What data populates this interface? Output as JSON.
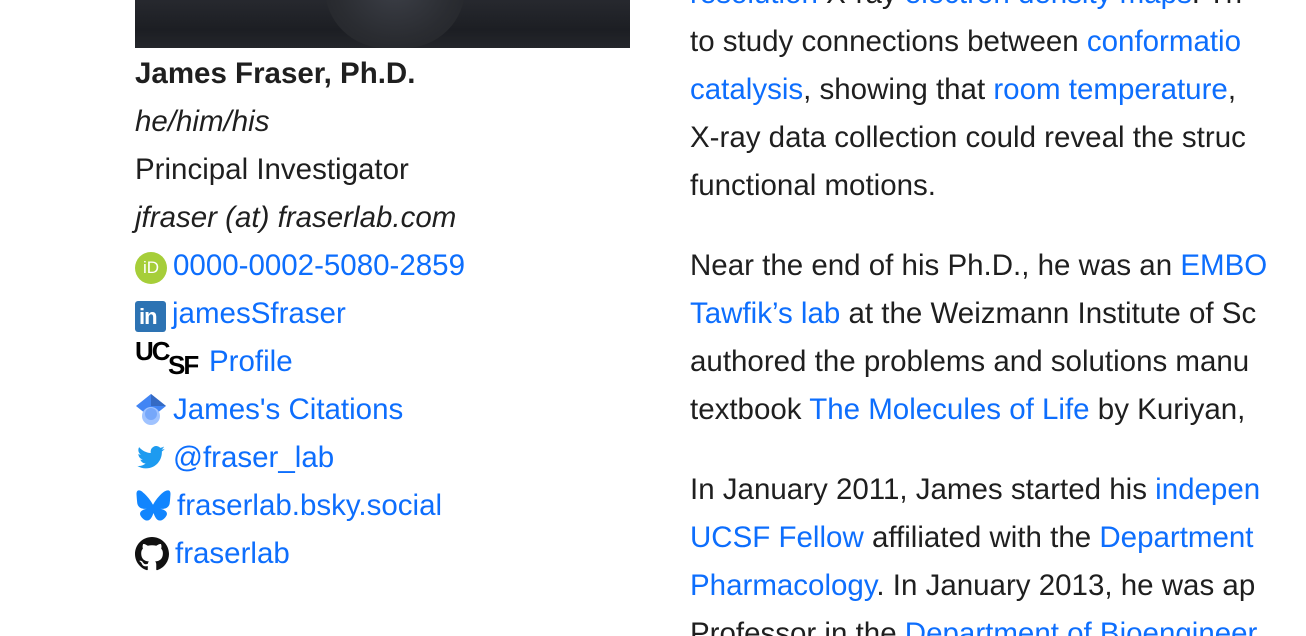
{
  "profile": {
    "name": "James Fraser, Ph.D.",
    "pronouns": "he/him/his",
    "role": "Principal Investigator",
    "email": "jfraser (at) fraserlab.com",
    "links": {
      "orcid": "0000-0002-5080-2859",
      "linkedin": "jamesSfraser",
      "ucsf": "Profile",
      "scholar": "James's Citations",
      "twitter": "@fraser_lab",
      "bluesky": "fraserlab.bsky.social",
      "github": "fraserlab"
    },
    "icons": {
      "orcid_glyph": "iD",
      "linkedin_glyph": "in",
      "ucsf_glyph_top": "UC",
      "ucsf_glyph_bottom": "SF"
    }
  },
  "bio": {
    "p1": {
      "l1a": "resolution",
      "l1b": " X-ray ",
      "l1c": "electron density maps",
      "l1d": ". Th",
      "l2a": "to study connections between ",
      "l2b": "conformatio",
      "l3a": "catalysis",
      "l3b": ", showing that ",
      "l3c": "room temperature",
      "l3d": ",",
      "l4": "X-ray data collection could reveal the struc",
      "l5": "functional motions."
    },
    "p2": {
      "l1a": "Near the end of his Ph.D., he was an ",
      "l1b": "EMBO",
      "l2a": "Tawfik’s lab",
      "l2b": " at the Weizmann Institute of Sc",
      "l3": "authored the problems and solutions manu",
      "l4a": "textbook ",
      "l4b": "The Molecules of Life",
      "l4c": " by Kuriyan,"
    },
    "p3": {
      "l1a": "In January 2011, James started his ",
      "l1b": "indepen",
      "l2a": "UCSF Fellow",
      "l2b": " affiliated with the ",
      "l2c": "Department",
      "l3a": "Pharmacology",
      "l3b": ". In January 2013, he was ap",
      "l4a": "Professor in the ",
      "l4b": "Department of Bioengineer"
    }
  },
  "colors": {
    "link": "#0d6efd",
    "text": "#1f1f1f",
    "orcid": "#a6ce39",
    "linkedin": "#2d73b3",
    "twitter": "#1d9bf0",
    "bluesky": "#1185fe"
  }
}
